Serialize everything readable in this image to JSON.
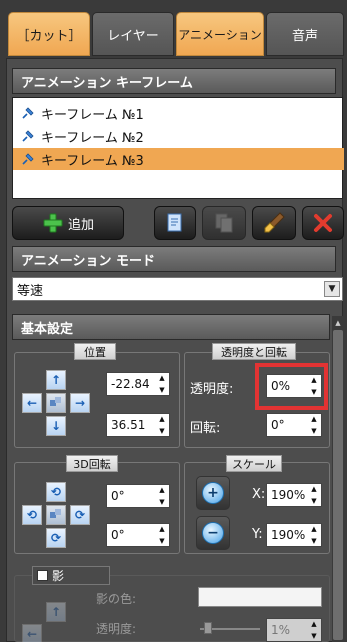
{
  "tabs": [
    {
      "label": "［カット］",
      "active": true
    },
    {
      "label": "レイヤー",
      "active": false
    },
    {
      "label": "アニメーション",
      "active": true
    },
    {
      "label": "音声",
      "active": false
    }
  ],
  "keyframe_section": {
    "title": "アニメーション キーフレーム",
    "items": [
      {
        "label": "キーフレーム №1",
        "selected": false
      },
      {
        "label": "キーフレーム №2",
        "selected": false
      },
      {
        "label": "キーフレーム №3",
        "selected": true
      }
    ],
    "add_label": "追加",
    "icons": [
      "copy-icon",
      "paste-icon",
      "brush-icon",
      "delete-icon"
    ]
  },
  "mode_section": {
    "title": "アニメーション モード",
    "value": "等速"
  },
  "basic_settings": {
    "title": "基本設定",
    "position": {
      "title": "位置",
      "x": "-22.84",
      "y": "36.51"
    },
    "opacity_rotation": {
      "title": "透明度と回転",
      "opacity_label": "透明度:",
      "opacity_value": "0%",
      "rotation_label": "回転:",
      "rotation_value": "0°"
    },
    "rotation3d": {
      "title": "3D回転",
      "a": "0°",
      "b": "0°"
    },
    "scale": {
      "title": "スケール",
      "x_label": "X:",
      "x_value": "190%",
      "y_label": "Y:",
      "y_value": "190%"
    },
    "shadow": {
      "title": "影",
      "color_label": "影の色:",
      "opacity_label": "透明度:",
      "opacity_value": "1%"
    }
  },
  "colors": {
    "accent": "#f0a752",
    "highlight_border": "#e23333"
  }
}
